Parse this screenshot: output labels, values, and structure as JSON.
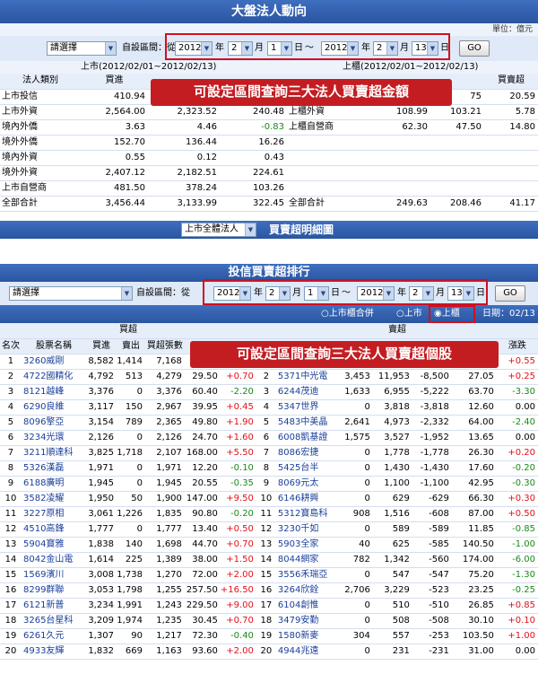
{
  "top": {
    "title": "大盤法人動向",
    "unit": "單位：億元",
    "select_label": "請選擇",
    "range_label": "自設區間：從",
    "from": {
      "year": "2012",
      "month": "2",
      "day": "1"
    },
    "to": {
      "year": "2012",
      "month": "2",
      "day": "13"
    },
    "u_year": "年",
    "u_month": "月",
    "u_day": "日",
    "tilde": "～",
    "go": "GO",
    "banner": "可設定區間查詢三大法人買賣超金額",
    "left_head": "上市(2012/02/01~2012/02/13)",
    "right_head": "上櫃(2012/02/01~2012/02/13)",
    "col_type": "法人類別",
    "col_buy": "買進",
    "col_net": "買賣超",
    "rows": [
      {
        "n": "上市投信",
        "a": "410.94",
        "b": "",
        "c": "",
        "rn": "",
        "ra": "",
        "rb": "75",
        "rc": "20.59"
      },
      {
        "n": "上市外資",
        "a": "2,564.00",
        "b": "2,323.52",
        "c": "240.48",
        "rn": "上櫃外資",
        "ra": "108.99",
        "rb": "103.21",
        "rc": "5.78"
      },
      {
        "n": "境內外僑",
        "a": "3.63",
        "b": "4.46",
        "c": "-0.83",
        "rn": "上櫃自營商",
        "ra": "62.30",
        "rb": "47.50",
        "rc": "14.80"
      },
      {
        "n": "境外外僑",
        "a": "152.70",
        "b": "136.44",
        "c": "16.26",
        "rn": "",
        "ra": "",
        "rb": "",
        "rc": ""
      },
      {
        "n": "境內外資",
        "a": "0.55",
        "b": "0.12",
        "c": "0.43",
        "rn": "",
        "ra": "",
        "rb": "",
        "rc": ""
      },
      {
        "n": "境外外資",
        "a": "2,407.12",
        "b": "2,182.51",
        "c": "224.61",
        "rn": "",
        "ra": "",
        "rb": "",
        "rc": ""
      },
      {
        "n": "上市自營商",
        "a": "481.50",
        "b": "378.24",
        "c": "103.26",
        "rn": "",
        "ra": "",
        "rb": "",
        "rc": ""
      },
      {
        "n": "全部合計",
        "a": "3,456.44",
        "b": "3,133.99",
        "c": "322.45",
        "rn": "全部合計",
        "ra": "249.63",
        "rb": "208.46",
        "rc": "41.17"
      }
    ],
    "footer_select": "上市全體法人",
    "footer_title": "買賣超明細圖"
  },
  "bottom": {
    "title": "投信買賣超排行",
    "select_label": "請選擇",
    "range_label": "自設區間：從",
    "from": {
      "year": "2012",
      "month": "2",
      "day": "1"
    },
    "to": {
      "year": "2012",
      "month": "2",
      "day": "13"
    },
    "go": "GO",
    "radio_all": "上市櫃合併",
    "radio_listed": "上市",
    "radio_otc": "上櫃",
    "date": "日期：02/13",
    "banner": "可設定區間查詢三大法人買賣超個股",
    "group_buy": "買超",
    "group_sell": "賣超",
    "h_rank": "名次",
    "h_name": "股票名稱",
    "h_buy": "買進",
    "h_sell": "賣出",
    "h_net": "買超張數",
    "h_chg": "漲跌",
    "rows": [
      {
        "r": "1",
        "s": "3260威剛",
        "b": "8,582",
        "se": "1,414",
        "n": "7,168",
        "p": "",
        "c": "",
        "r2": "1",
        "s2": "",
        "b2": "",
        "se2": "",
        "n2": "",
        "p2": "",
        "c2": "+0.55"
      },
      {
        "r": "2",
        "s": "4722國精化",
        "b": "4,792",
        "se": "513",
        "n": "4,279",
        "p": "29.50",
        "c": "+0.70",
        "r2": "2",
        "s2": "5371中光電",
        "b2": "3,453",
        "se2": "11,953",
        "n2": "-8,500",
        "p2": "27.05",
        "c2": "+0.25"
      },
      {
        "r": "3",
        "s": "8121越峰",
        "b": "3,376",
        "se": "0",
        "n": "3,376",
        "p": "60.40",
        "c": "-2.20",
        "r2": "3",
        "s2": "6244茂迪",
        "b2": "1,633",
        "se2": "6,955",
        "n2": "-5,222",
        "p2": "63.70",
        "c2": "-3.30"
      },
      {
        "r": "4",
        "s": "6290良維",
        "b": "3,117",
        "se": "150",
        "n": "2,967",
        "p": "39.95",
        "c": "+0.45",
        "r2": "4",
        "s2": "5347世界",
        "b2": "0",
        "se2": "3,818",
        "n2": "-3,818",
        "p2": "12.60",
        "c2": "0.00"
      },
      {
        "r": "5",
        "s": "8096擎亞",
        "b": "3,154",
        "se": "789",
        "n": "2,365",
        "p": "49.80",
        "c": "+1.90",
        "r2": "5",
        "s2": "5483中美晶",
        "b2": "2,641",
        "se2": "4,973",
        "n2": "-2,332",
        "p2": "64.00",
        "c2": "-2.40"
      },
      {
        "r": "6",
        "s": "3234光環",
        "b": "2,126",
        "se": "0",
        "n": "2,126",
        "p": "24.70",
        "c": "+1.60",
        "r2": "6",
        "s2": "6008凱基證",
        "b2": "1,575",
        "se2": "3,527",
        "n2": "-1,952",
        "p2": "13.65",
        "c2": "0.00"
      },
      {
        "r": "7",
        "s": "3211順達科",
        "b": "3,825",
        "se": "1,718",
        "n": "2,107",
        "p": "168.00",
        "c": "+5.50",
        "r2": "7",
        "s2": "8086宏捷",
        "b2": "0",
        "se2": "1,778",
        "n2": "-1,778",
        "p2": "26.30",
        "c2": "+0.20"
      },
      {
        "r": "8",
        "s": "5326漢磊",
        "b": "1,971",
        "se": "0",
        "n": "1,971",
        "p": "12.20",
        "c": "-0.10",
        "r2": "8",
        "s2": "5425台半",
        "b2": "0",
        "se2": "1,430",
        "n2": "-1,430",
        "p2": "17.60",
        "c2": "-0.20"
      },
      {
        "r": "9",
        "s": "6188廣明",
        "b": "1,945",
        "se": "0",
        "n": "1,945",
        "p": "20.55",
        "c": "-0.35",
        "r2": "9",
        "s2": "8069元太",
        "b2": "0",
        "se2": "1,100",
        "n2": "-1,100",
        "p2": "42.95",
        "c2": "-0.30"
      },
      {
        "r": "10",
        "s": "3582凌耀",
        "b": "1,950",
        "se": "50",
        "n": "1,900",
        "p": "147.00",
        "c": "+9.50",
        "r2": "10",
        "s2": "6146耕興",
        "b2": "0",
        "se2": "629",
        "n2": "-629",
        "p2": "66.30",
        "c2": "+0.30"
      },
      {
        "r": "11",
        "s": "3227原相",
        "b": "3,061",
        "se": "1,226",
        "n": "1,835",
        "p": "90.80",
        "c": "-0.20",
        "r2": "11",
        "s2": "5312寶島科",
        "b2": "908",
        "se2": "1,516",
        "n2": "-608",
        "p2": "87.00",
        "c2": "+0.50"
      },
      {
        "r": "12",
        "s": "4510高鋒",
        "b": "1,777",
        "se": "0",
        "n": "1,777",
        "p": "13.40",
        "c": "+0.50",
        "r2": "12",
        "s2": "3230千如",
        "b2": "0",
        "se2": "589",
        "n2": "-589",
        "p2": "11.85",
        "c2": "-0.85"
      },
      {
        "r": "13",
        "s": "5904寶雅",
        "b": "1,838",
        "se": "140",
        "n": "1,698",
        "p": "44.70",
        "c": "+0.70",
        "r2": "13",
        "s2": "5903全家",
        "b2": "40",
        "se2": "625",
        "n2": "-585",
        "p2": "140.50",
        "c2": "-1.00"
      },
      {
        "r": "14",
        "s": "8042金山電",
        "b": "1,614",
        "se": "225",
        "n": "1,389",
        "p": "38.00",
        "c": "+1.50",
        "r2": "14",
        "s2": "8044網家",
        "b2": "782",
        "se2": "1,342",
        "n2": "-560",
        "p2": "174.00",
        "c2": "-6.00"
      },
      {
        "r": "15",
        "s": "1569濱川",
        "b": "3,008",
        "se": "1,738",
        "n": "1,270",
        "p": "72.00",
        "c": "+2.00",
        "r2": "15",
        "s2": "3556禾瑞亞",
        "b2": "0",
        "se2": "547",
        "n2": "-547",
        "p2": "75.20",
        "c2": "-1.30"
      },
      {
        "r": "16",
        "s": "8299群聯",
        "b": "3,053",
        "se": "1,798",
        "n": "1,255",
        "p": "257.50",
        "c": "+16.50",
        "r2": "16",
        "s2": "3264欣銓",
        "b2": "2,706",
        "se2": "3,229",
        "n2": "-523",
        "p2": "23.25",
        "c2": "-0.25"
      },
      {
        "r": "17",
        "s": "6121新普",
        "b": "3,234",
        "se": "1,991",
        "n": "1,243",
        "p": "229.50",
        "c": "+9.00",
        "r2": "17",
        "s2": "6104創惟",
        "b2": "0",
        "se2": "510",
        "n2": "-510",
        "p2": "26.85",
        "c2": "+0.85"
      },
      {
        "r": "18",
        "s": "3265台星科",
        "b": "3,209",
        "se": "1,974",
        "n": "1,235",
        "p": "30.45",
        "c": "+0.70",
        "r2": "18",
        "s2": "3479安勤",
        "b2": "0",
        "se2": "508",
        "n2": "-508",
        "p2": "30.10",
        "c2": "+0.10"
      },
      {
        "r": "19",
        "s": "6261久元",
        "b": "1,307",
        "se": "90",
        "n": "1,217",
        "p": "72.30",
        "c": "-0.40",
        "r2": "19",
        "s2": "1580新麥",
        "b2": "304",
        "se2": "557",
        "n2": "-253",
        "p2": "103.50",
        "c2": "+1.00"
      },
      {
        "r": "20",
        "s": "4933友輝",
        "b": "1,832",
        "se": "669",
        "n": "1,163",
        "p": "93.60",
        "c": "+2.00",
        "r2": "20",
        "s2": "4944兆遠",
        "b2": "0",
        "se2": "231",
        "n2": "-231",
        "p2": "31.00",
        "c2": "0.00"
      }
    ]
  }
}
